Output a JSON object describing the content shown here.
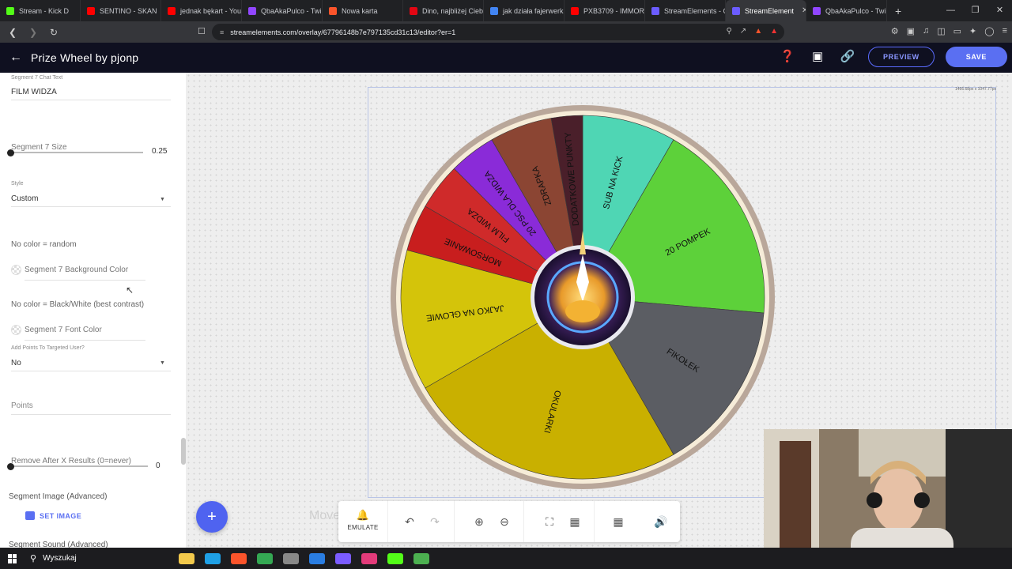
{
  "browser": {
    "tabs": [
      {
        "title": "Stream - Kick D",
        "color": "#53fc18"
      },
      {
        "title": "SENTINO - SKAN",
        "color": "#ff0000"
      },
      {
        "title": "jednak bękart - You",
        "color": "#ff0000"
      },
      {
        "title": "QbaAkaPulco - Twi",
        "color": "#9146ff"
      },
      {
        "title": "Nowa karta",
        "color": "#fb542b"
      },
      {
        "title": "Dino, najbliżej Cieb",
        "color": "#e30613"
      },
      {
        "title": "jak działa fajerwerk",
        "color": "#4285f4"
      },
      {
        "title": "PXB3709 - IMMORT",
        "color": "#ff0000"
      },
      {
        "title": "StreamElements - C",
        "color": "#6b5cff"
      },
      {
        "title": "StreamElement",
        "color": "#6b5cff",
        "active": true
      },
      {
        "title": "QbaAkaPulco - Twi",
        "color": "#9146ff"
      }
    ],
    "url": "streamelements.com/overlay/67796148b7e797135cd31c13/editor?er=1"
  },
  "header": {
    "title": "Prize Wheel by pjonp",
    "preview_label": "PREVIEW",
    "save_label": "SAVE"
  },
  "panel": {
    "chat_text_label": "Segment 7 Chat Text",
    "chat_text_value": "FILM WIDZA",
    "size_label": "Segment 7 Size",
    "size_value": "0.25",
    "style_label": "Style",
    "style_value": "Custom",
    "no_color_random": "No color = random",
    "bg_color_label": "Segment 7 Background Color",
    "no_color_contrast": "No color = Black/White (best contrast)",
    "font_color_label": "Segment 7 Font Color",
    "add_points_label": "Add Points To Targeted User?",
    "add_points_value": "No",
    "points_placeholder": "Points",
    "remove_after_label": "Remove After X Results (0=never)",
    "remove_after_value": "0",
    "segment_image_head": "Segment Image (Advanced)",
    "set_image_label": "SET IMAGE",
    "segment_sound_head": "Segment Sound (Advanced)"
  },
  "canvas": {
    "dimensions": "1466.68px x 1047.77px",
    "move_hint": "Move",
    "wheel_segments": [
      {
        "label": "SUB NA KICK",
        "color": "#4fd6b4"
      },
      {
        "label": "20 POMPEK",
        "color": "#5dd13a"
      },
      {
        "label": "FIKOŁEK",
        "color": "#5b5d63"
      },
      {
        "label": "OKULARKI",
        "color": "#c9b000"
      },
      {
        "label": "JAJKO NA GŁOWIE",
        "color": "#d4c40a"
      },
      {
        "label": "MORSOWANIE",
        "color": "#c81e1e"
      },
      {
        "label": "FILM WIDZA",
        "color": "#cf2a2a"
      },
      {
        "label": "20 PSC DLA WIDZA",
        "color": "#8a2bd8"
      },
      {
        "label": "ZDRAPKA",
        "color": "#8b4533"
      },
      {
        "label": "DODATKOWE PUNKTY",
        "color": "#4a1f2a"
      }
    ]
  },
  "toolbar": {
    "emulate_label": "EMULATE"
  },
  "taskbar": {
    "search_label": "Wyszukaj"
  }
}
